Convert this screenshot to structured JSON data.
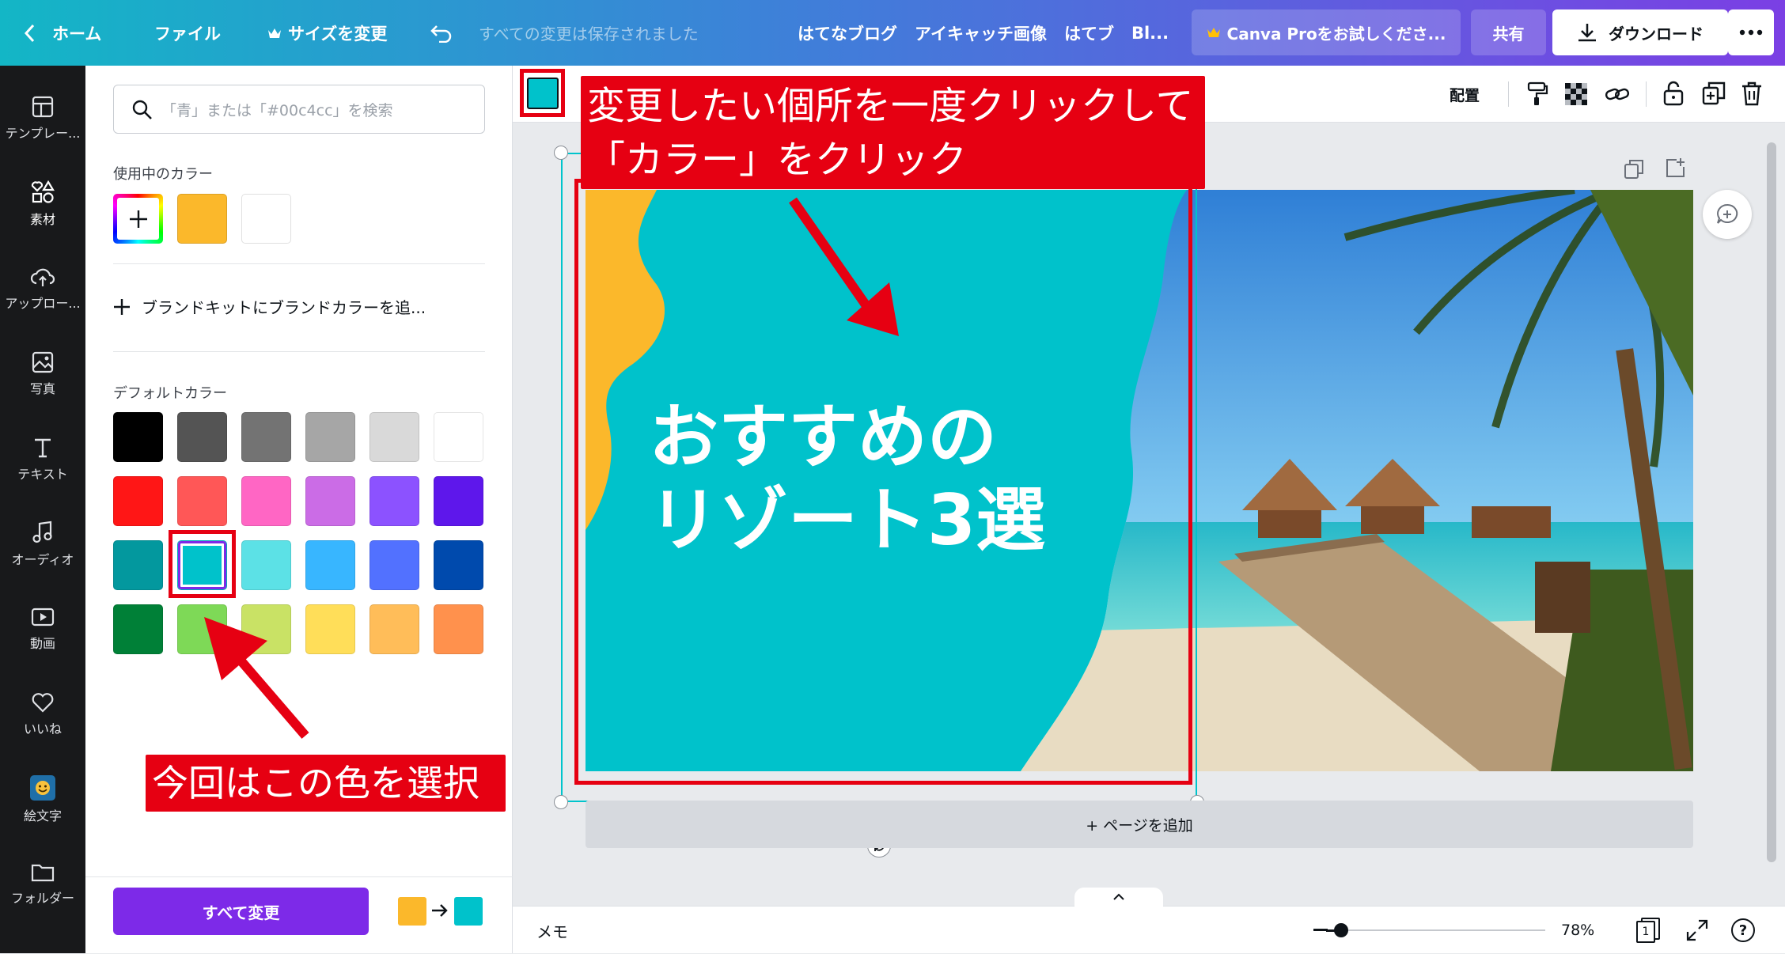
{
  "topbar": {
    "home": "ホーム",
    "file": "ファイル",
    "resize": "サイズを変更",
    "saved_status": "すべての変更は保存されました",
    "title_parts": [
      "はてなブログ",
      "アイキャッチ画像",
      "はてブ",
      "Bl..."
    ],
    "pro_trial": "Canva Proをお試しくださ...",
    "share": "共有",
    "download": "ダウンロード"
  },
  "rail": [
    {
      "label": "テンプレー...",
      "icon": "template-icon"
    },
    {
      "label": "素材",
      "icon": "elements-icon"
    },
    {
      "label": "アップロー...",
      "icon": "upload-icon"
    },
    {
      "label": "写真",
      "icon": "photo-icon"
    },
    {
      "label": "テキスト",
      "icon": "text-icon"
    },
    {
      "label": "オーディオ",
      "icon": "audio-icon"
    },
    {
      "label": "動画",
      "icon": "video-icon"
    },
    {
      "label": "いいね",
      "icon": "heart-icon"
    },
    {
      "label": "絵文字",
      "icon": "emoji-icon"
    },
    {
      "label": "フォルダー",
      "icon": "folder-icon"
    }
  ],
  "panel": {
    "search_placeholder": "「青」または「#00c4cc」を検索",
    "in_use_title": "使用中のカラー",
    "in_use_colors": [
      "#fbb82b",
      "#ffffff"
    ],
    "brand_kit": "ブランドキットにブランドカラーを追...",
    "default_title": "デフォルトカラー",
    "default_colors": [
      [
        "#000000",
        "#545454",
        "#737373",
        "#a6a6a6",
        "#d9d9d9",
        "#ffffff"
      ],
      [
        "#ff1616",
        "#ff5757",
        "#ff66c4",
        "#cb6ce6",
        "#8c52ff",
        "#5e17eb"
      ],
      [
        "#03989e",
        "#00c2cb",
        "#5ce1e6",
        "#38b6ff",
        "#5271ff",
        "#004aad"
      ],
      [
        "#008037",
        "#7ed957",
        "#c9e265",
        "#ffde59",
        "#ffbd59",
        "#ff914d"
      ]
    ],
    "change_all": "すべて変更",
    "from_color": "#fbb82b",
    "to_color": "#00c2cb"
  },
  "toolbar": {
    "selected_color": "#00c2cb",
    "position": "配置"
  },
  "design": {
    "headline_line1": "おすすめの",
    "headline_line2": "リゾート3選",
    "bg_color": "#00c2cb",
    "accent_color": "#fbb82b"
  },
  "add_page": "+ ページを追加",
  "footer": {
    "notes": "メモ",
    "zoom": "78%",
    "page": "1",
    "help": "?"
  },
  "annotations": {
    "top_line1": "変更したい個所を一度クリックして",
    "top_line2": "「カラー」をクリック",
    "bottom": "今回はこの色を選択"
  }
}
